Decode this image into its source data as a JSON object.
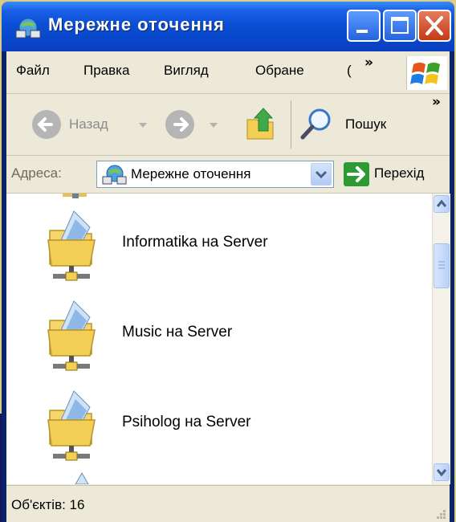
{
  "window": {
    "title": "Мережне оточення"
  },
  "menu": {
    "items": [
      "Файл",
      "Правка",
      "Вигляд",
      "Обране",
      "("
    ],
    "overflow": "»"
  },
  "toolbar": {
    "back_label": "Назад",
    "search_label": "Пошук",
    "overflow": "»"
  },
  "address": {
    "label": "Адреса:",
    "value": "Мережне оточення",
    "go_label": "Перехід"
  },
  "list": {
    "items": [
      {
        "label": "Informatika на Server"
      },
      {
        "label": "Music на Server"
      },
      {
        "label": "Psiholog на Server"
      }
    ]
  },
  "status": {
    "text": "Об'єктів: 16"
  },
  "colors": {
    "titlebar": "#0a4fd4",
    "frame": "#ece9d8",
    "close": "#c23b16"
  }
}
